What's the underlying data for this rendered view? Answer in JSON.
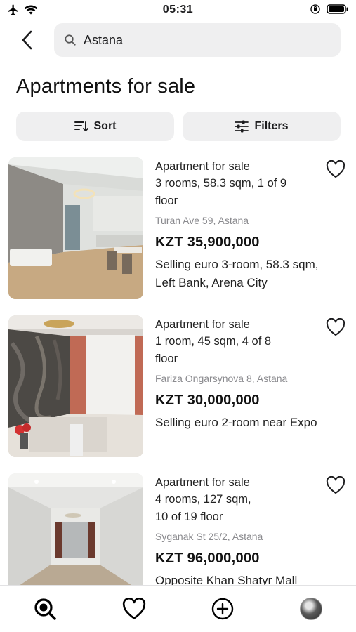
{
  "status_bar": {
    "time": "05:31",
    "left_icons": [
      "airplane-icon",
      "wifi-icon"
    ],
    "right_icons": [
      "orientation-lock-icon",
      "battery-icon"
    ]
  },
  "header": {
    "back_icon": "chevron-left-icon",
    "search": {
      "icon": "search-icon",
      "value": "Astana",
      "placeholder": ""
    }
  },
  "page": {
    "title": "Apartments for sale"
  },
  "actions": {
    "sort_label": "Sort",
    "sort_icon": "sort-icon",
    "filters_label": "Filters",
    "filters_icon": "sliders-icon"
  },
  "listings": [
    {
      "type": "Apartment for sale",
      "spec_line1": "3 rooms, 58.3 sqm, 1 of 9",
      "spec_line2": "floor",
      "address": "Turan Ave 59, Astana",
      "price": "KZT 35,900,000",
      "description": "Selling euro 3-room, 58.3 sqm, Left Bank, Arena City",
      "favorite_icon": "heart-outline-icon"
    },
    {
      "type": "Apartment for sale",
      "spec_line1": "1 room, 45 sqm, 4 of 8",
      "spec_line2": "floor",
      "address": "Fariza Ongarsynova 8, Astana",
      "price": "KZT 30,000,000",
      "description": "Selling euro 2-room near Expo",
      "favorite_icon": "heart-outline-icon"
    },
    {
      "type": "Apartment for sale",
      "spec_line1": "4 rooms, 127 sqm,",
      "spec_line2": "10 of 19 floor",
      "address": "Syganak St 25/2, Astana",
      "price": "KZT 96,000,000",
      "description": "Opposite Khan Shatyr Mall",
      "favorite_icon": "heart-outline-icon"
    }
  ],
  "tab_bar": {
    "items": [
      "search-tab-icon",
      "favorites-tab-icon",
      "add-listing-tab-icon",
      "profile-avatar"
    ]
  }
}
